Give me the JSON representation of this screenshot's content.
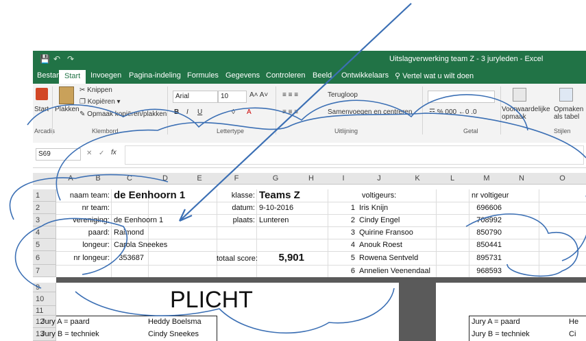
{
  "window": {
    "title": "Uitslagverwerking team Z - 3 juryleden  -  Excel"
  },
  "ribbon": {
    "tabs": [
      "Bestand",
      "Start",
      "Invoegen",
      "Pagina-indeling",
      "Formules",
      "Gegevens",
      "Controleren",
      "Beeld",
      "Ontwikkelaars"
    ],
    "tell_me": "Vertel wat u wilt doen",
    "clipboard": {
      "paste": "Plakken",
      "cut": "Knippen",
      "copy": "Kopiëren",
      "format_painter": "Opmaak kopiëren/plakken",
      "group": "Klembord"
    },
    "start_btn": "Start",
    "arcadis": "Arcadis",
    "font": {
      "name": "Arial",
      "size": "10",
      "group": "Lettertype"
    },
    "alignment": {
      "wrap": "Terugloop",
      "merge": "Samenvoegen en centreren",
      "group": "Uitlijning"
    },
    "number": {
      "group": "Getal"
    },
    "styles": {
      "conditional": "Voorwaardelijke opmaak",
      "table": "Opmaken als tabel",
      "group": "Stijlen"
    }
  },
  "formula_bar": {
    "name_box": "S69",
    "fx": "fx"
  },
  "columns": [
    "A",
    "B",
    "C",
    "D",
    "E",
    "F",
    "G",
    "H",
    "I",
    "J",
    "K",
    "L",
    "M",
    "N",
    "O"
  ],
  "rows": [
    "1",
    "2",
    "3",
    "4",
    "5",
    "6",
    "7",
    "9",
    "10",
    "11",
    "12",
    "13"
  ],
  "cells": {
    "b1": "naam team:",
    "c1": "de Eenhoorn 1",
    "b2": "nr team:",
    "b3": "vereniging:",
    "c3": "de Eenhoorn 1",
    "b4": "paard:",
    "c4": "Raimond",
    "b5": "longeur:",
    "c5": "Carola Sneekes",
    "b6": "nr longeur:",
    "c6": "353687",
    "f1": "klasse:",
    "g1": "Teams Z",
    "f2": "datum:",
    "g2": "9-10-2016",
    "f3": "plaats:",
    "g3": "Lunteren",
    "f6": "totaal score:",
    "g6": "5,901",
    "j1": "voltigeurs:",
    "m1": "nr voltigeur",
    "voltigeurs": [
      {
        "nr": "1",
        "name": "Iris Knijn",
        "id": "696606"
      },
      {
        "nr": "2",
        "name": "Cindy Engel",
        "id": "708992"
      },
      {
        "nr": "3",
        "name": "Quirine Fransoo",
        "id": "850790"
      },
      {
        "nr": "4",
        "name": "Anouk Roest",
        "id": "850441"
      },
      {
        "nr": "5",
        "name": "Rowena Sentveld",
        "id": "895731"
      },
      {
        "nr": "6",
        "name": "Annelien Veenendaal",
        "id": "968593"
      }
    ],
    "plicht": "PLICHT",
    "a12": "Jury A = paard",
    "d12": "Heddy Boelsma",
    "a13": "Jury B = techniek",
    "d13": "Cindy Sneekes",
    "m12": "Jury A = paard",
    "o12": "He",
    "m13": "Jury B = techniek",
    "o13": "Ci"
  },
  "colors": {
    "excel_green": "#217346",
    "annotation": "#3b6fb4"
  }
}
